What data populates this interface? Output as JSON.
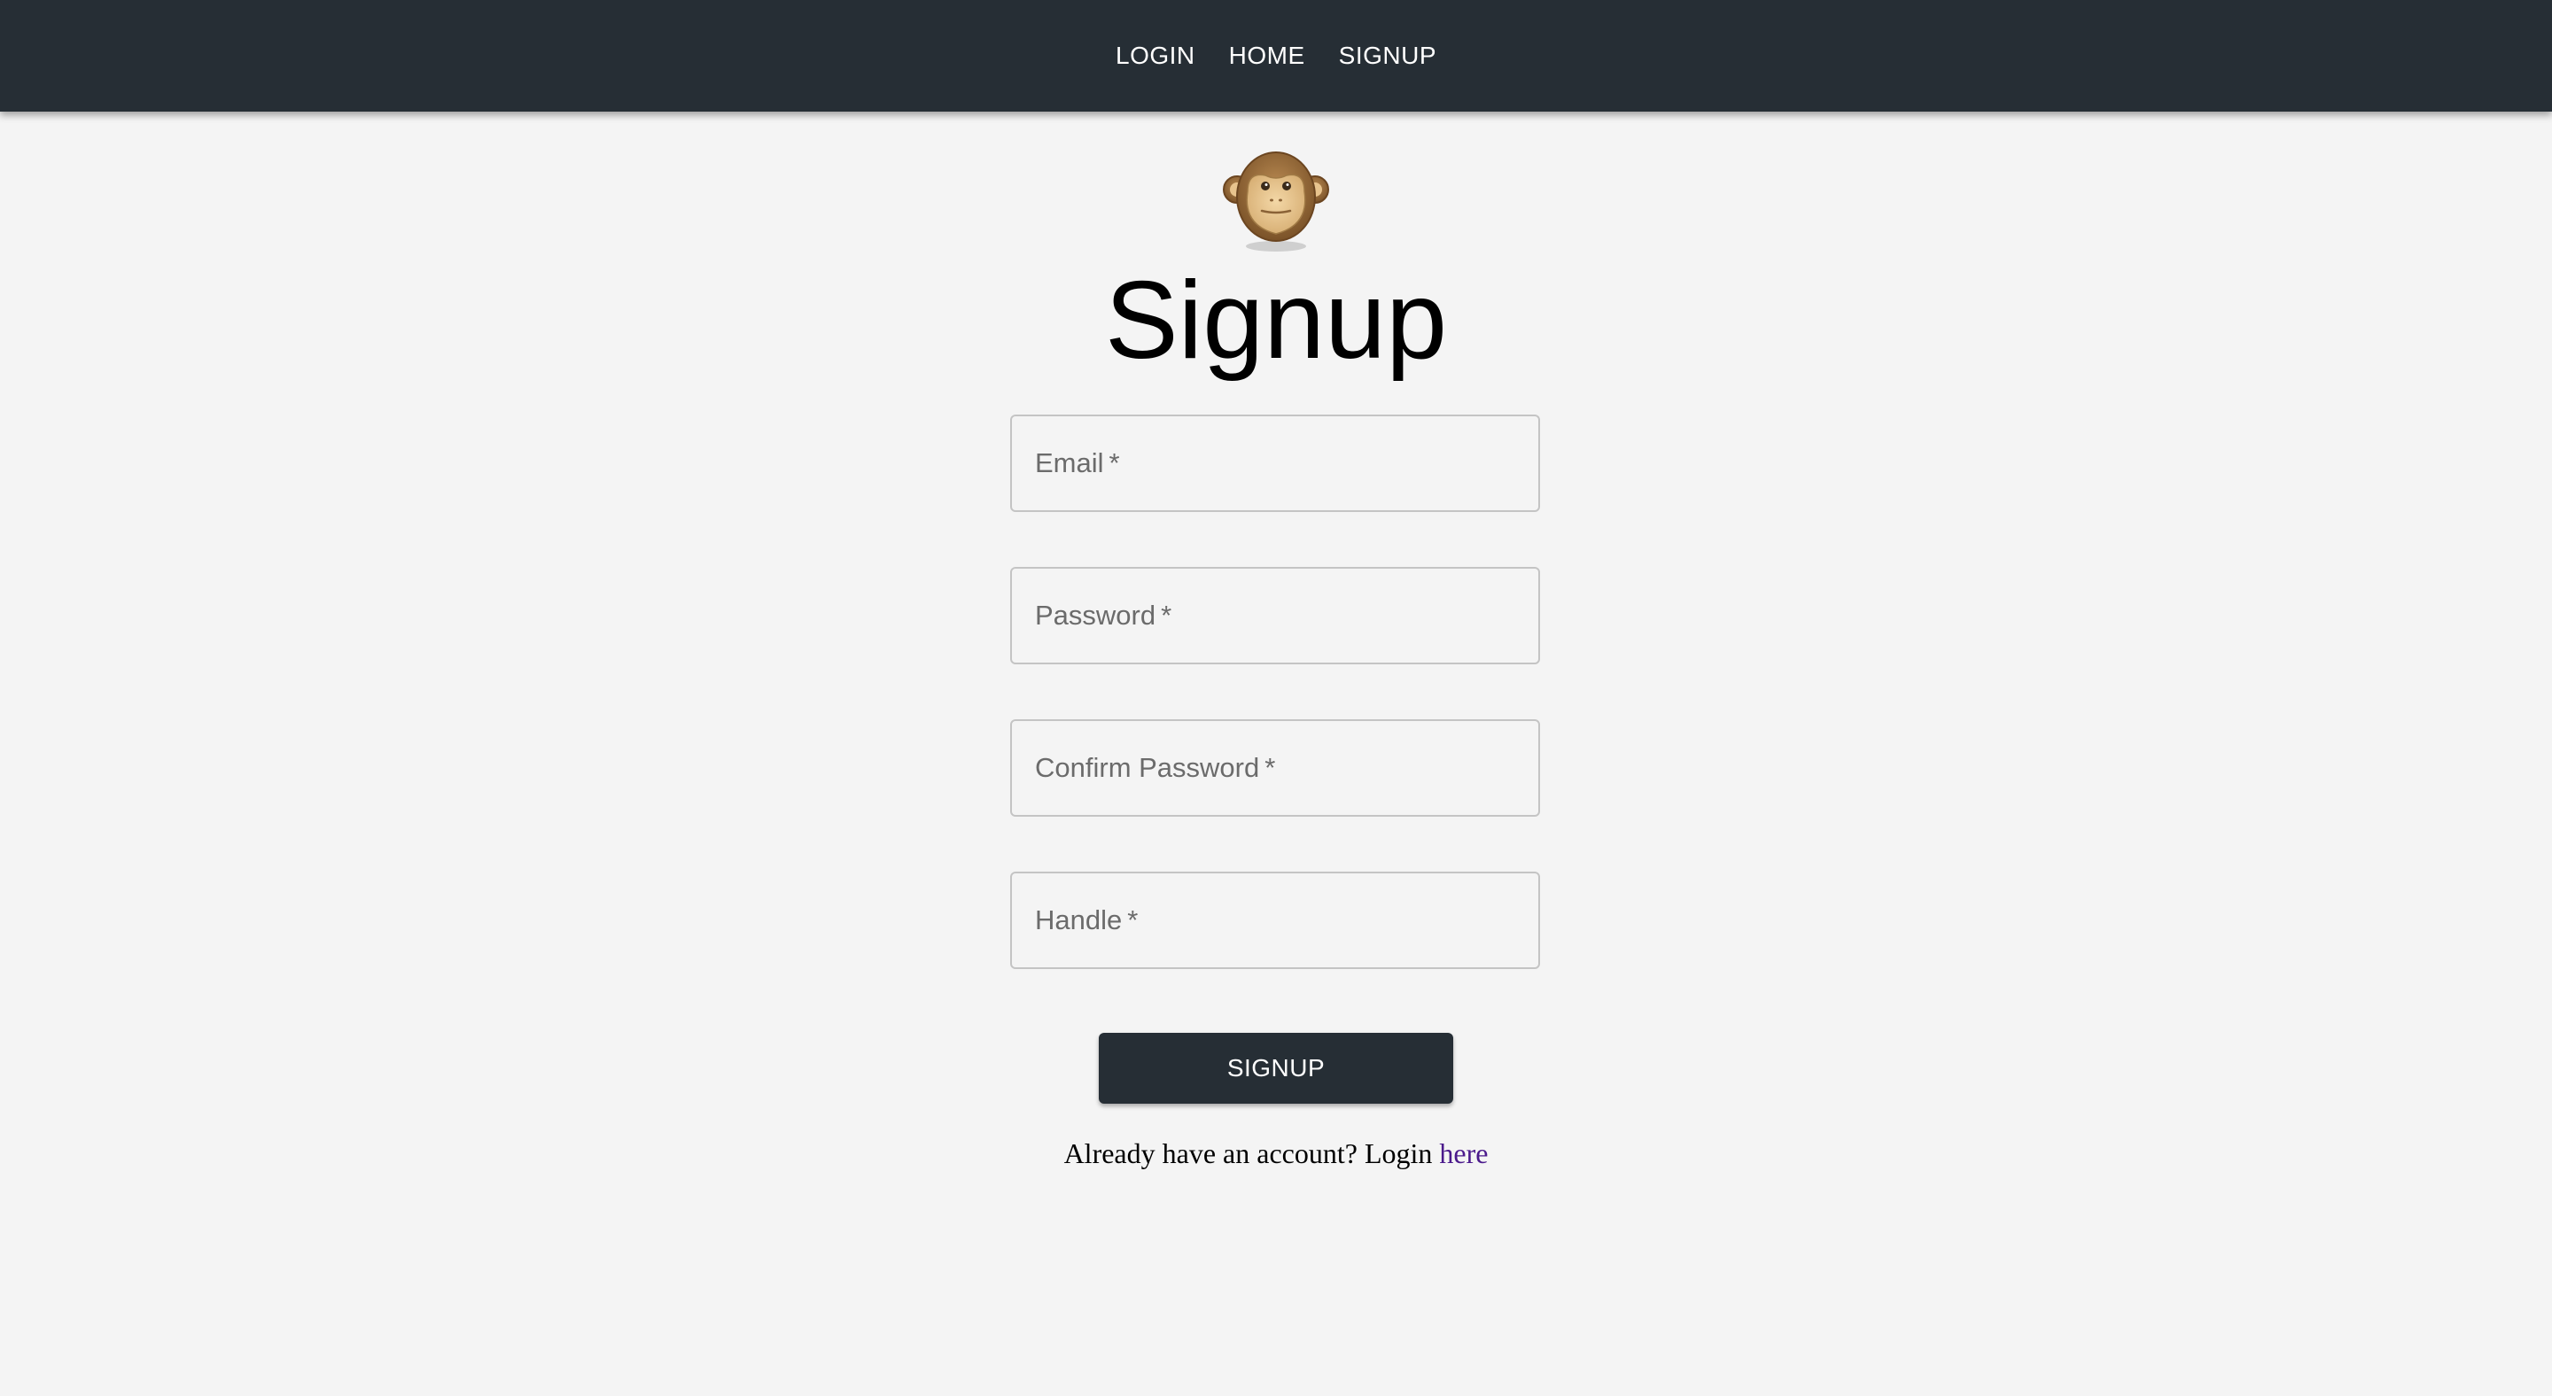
{
  "nav": {
    "items": [
      {
        "label": "LOGIN"
      },
      {
        "label": "HOME"
      },
      {
        "label": "SIGNUP"
      }
    ]
  },
  "logo": {
    "icon": "monkey-face-icon"
  },
  "page": {
    "title": "Signup"
  },
  "form": {
    "fields": [
      {
        "label": "Email",
        "required": "*",
        "value": ""
      },
      {
        "label": "Password",
        "required": "*",
        "value": ""
      },
      {
        "label": "Confirm Password",
        "required": "*",
        "value": ""
      },
      {
        "label": "Handle",
        "required": "*",
        "value": ""
      }
    ],
    "submit_label": "SIGNUP"
  },
  "footer": {
    "prompt": "Already have an account? Login ",
    "link_text": "here"
  },
  "colors": {
    "topbar": "#262e35",
    "background": "#f4f4f4",
    "link": "#4b1a8c"
  }
}
